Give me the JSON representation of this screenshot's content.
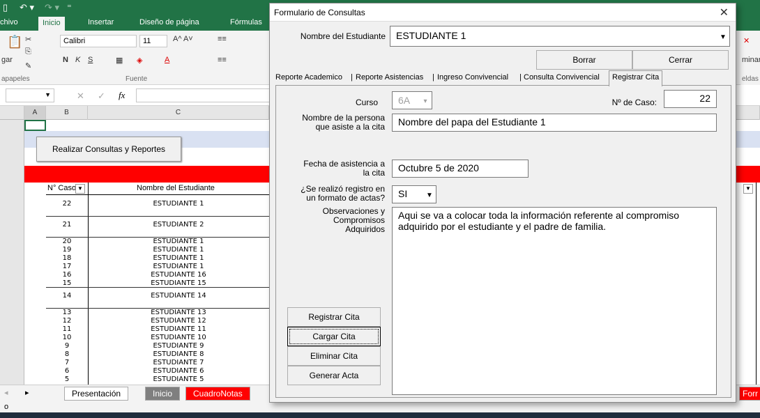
{
  "excel": {
    "ribbon_tabs": [
      "chivo",
      "Inicio",
      "Insertar",
      "Diseño de página",
      "Fórmulas"
    ],
    "ribbon": {
      "font_name": "Calibri",
      "font_size": "11",
      "group_clipboard": "apapeles",
      "group_font": "Fuente",
      "paste_label": "gar",
      "right_cut_1": "minar",
      "right_cut_2": "eldas"
    },
    "formula_fx": "fx",
    "col_headers": [
      "A",
      "B",
      "C"
    ],
    "macro_button": "Realizar Consultas y Reportes",
    "table_headers": {
      "caso": "N° Caso",
      "nombre": "Nombre del Estudiante"
    },
    "rows": [
      {
        "caso": "22",
        "nombre": "ESTUDIANTE 1"
      },
      {
        "caso": "21",
        "nombre": "ESTUDIANTE 2"
      },
      {
        "caso": "20",
        "nombre": "ESTUDIANTE 1"
      },
      {
        "caso": "19",
        "nombre": "ESTUDIANTE 1"
      },
      {
        "caso": "18",
        "nombre": "ESTUDIANTE 1"
      },
      {
        "caso": "17",
        "nombre": "ESTUDIANTE 1"
      },
      {
        "caso": "16",
        "nombre": "ESTUDIANTE 16"
      },
      {
        "caso": "15",
        "nombre": "ESTUDIANTE 15"
      },
      {
        "caso": "14",
        "nombre": "ESTUDIANTE 14"
      },
      {
        "caso": "13",
        "nombre": "ESTUDIANTE 13"
      },
      {
        "caso": "12",
        "nombre": "ESTUDIANTE 12"
      },
      {
        "caso": "11",
        "nombre": "ESTUDIANTE 11"
      },
      {
        "caso": "10",
        "nombre": "ESTUDIANTE 10"
      },
      {
        "caso": "9",
        "nombre": "ESTUDIANTE 9"
      },
      {
        "caso": "8",
        "nombre": "ESTUDIANTE 8"
      },
      {
        "caso": "7",
        "nombre": "ESTUDIANTE 7"
      },
      {
        "caso": "6",
        "nombre": "ESTUDIANTE 6"
      },
      {
        "caso": "5",
        "nombre": "ESTUDIANTE 5"
      }
    ],
    "sheet_tabs": [
      "Presentación",
      "Inicio",
      "CuadroNotas"
    ],
    "sheet_tab_right": "Forr",
    "status": "o",
    "colors": {
      "excel_green": "#217346",
      "red_band": "#ff0000",
      "blue_band": "#d9e1f2"
    }
  },
  "dialog": {
    "title": "Formulario de Consultas",
    "student_label": "Nombre del Estudiante",
    "student_value": "ESTUDIANTE 1",
    "btn_borrar": "Borrar",
    "btn_cerrar": "Cerrar",
    "tabs": [
      "Reporte Academico",
      "Reporte Asistencias",
      "Ingreso Convivencial",
      "Consulta Convivencial",
      "Registrar Cita"
    ],
    "active_tab": "Registrar Cita",
    "curso_label": "Curso",
    "curso_value": "6A",
    "caso_label": "Nº de Caso:",
    "caso_value": "22",
    "persona_label_1": "Nombre de la persona",
    "persona_label_2": "que asiste a la cita",
    "persona_value": "Nombre del papa del Estudiante 1",
    "fecha_label_1": "Fecha de asistencia a",
    "fecha_label_2": "la cita",
    "fecha_value": "Octubre 5 de 2020",
    "registro_label_1": "¿Se realizó registro en",
    "registro_label_2": "un formato de actas?",
    "registro_value": "SI",
    "obs_label_1": "Observaciones y",
    "obs_label_2": "Compromisos",
    "obs_label_3": "Adquiridos",
    "obs_value": "Aqui se va a colocar toda la información referente al compromiso adquirido por el estudiante y el padre de familia.",
    "btn_registrar": "Registrar Cita",
    "btn_cargar": "Cargar Cita",
    "btn_eliminar": "Eliminar Cita",
    "btn_generar": "Generar Acta",
    "close_icon": "close-icon"
  }
}
